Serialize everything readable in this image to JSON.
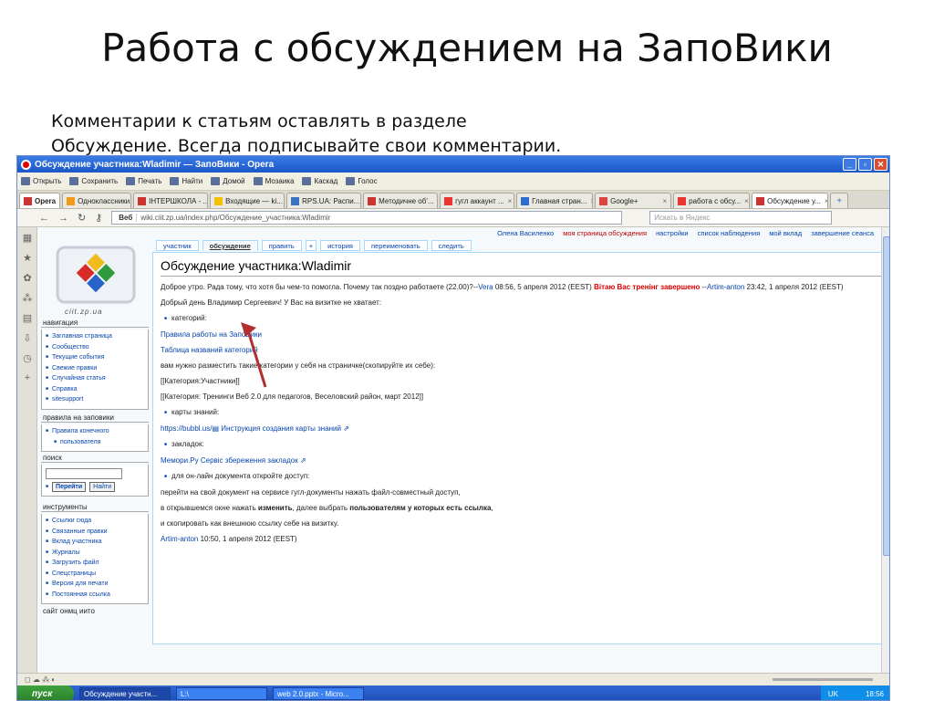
{
  "slide": {
    "title": "Работа с обсуждением на ЗапоВики",
    "text_line1": "Комментарии к статьям оставлять в разделе",
    "text_line2": "Обсуждение. Всегда подписывайте свои комментарии."
  },
  "window": {
    "title": "Обсуждение участника:Wladimir — ЗапоВики - Opera"
  },
  "toolbar": [
    "Открыть",
    "Сохранить",
    "Печать",
    "Найти",
    "Домой",
    "Мозаика",
    "Каскад",
    "Голос"
  ],
  "tabs": [
    {
      "label": "Opera",
      "active": false,
      "opera": true
    },
    {
      "label": "Одноклассники",
      "active": false
    },
    {
      "label": "ІНТЕРШКОЛА - ...",
      "active": false
    },
    {
      "label": "Входящие — ki...",
      "active": false
    },
    {
      "label": "RPS.UA: Распи...",
      "active": false
    },
    {
      "label": "Методичне об'...",
      "active": false
    },
    {
      "label": "гугл аккаунт ...",
      "active": false
    },
    {
      "label": "Главная стран...",
      "active": false
    },
    {
      "label": "Google+",
      "active": false
    },
    {
      "label": "работа с обсу...",
      "active": false
    },
    {
      "label": "Обсуждение у...",
      "active": true
    }
  ],
  "address": {
    "web_label": "Веб",
    "url": "wiki.ciit.zp.ua/index.php/Обсуждение_участника:Wladimir",
    "search_placeholder": "Искать в Яндекс"
  },
  "usernav": {
    "user": "Олена Василенко",
    "new_talk": "моя страница обсуждения",
    "items": [
      "настройки",
      "список наблюдения",
      "мой вклад",
      "завершение сеанса"
    ]
  },
  "logo_caption": "ciit.zp.ua",
  "sidebar": {
    "navigation": {
      "title": "навигация",
      "items": [
        "Заглавная страница",
        "Сообщество",
        "Текущие события",
        "Свежие правки",
        "Случайная статья",
        "Справка",
        "sitesupport"
      ]
    },
    "rules": {
      "title": "правила на заповики",
      "items": [
        "Правила конечного",
        "пользователя"
      ]
    },
    "search": {
      "title": "поиск",
      "go": "Перейти",
      "find": "Найти"
    },
    "tools": {
      "title": "инструменты",
      "items": [
        "Ссылки сюда",
        "Связанные правки",
        "Вклад участника",
        "Журналы",
        "Загрузить файл",
        "Спецстраницы",
        "Версия для печати",
        "Постоянная ссылка"
      ]
    },
    "site": {
      "title": "сайт онмц иито"
    }
  },
  "page_tabs": [
    "участник",
    "обсуждение",
    "править",
    "+",
    "история",
    "переименовать",
    "следить"
  ],
  "content": {
    "heading": "Обсуждение участника:Wladimir",
    "p1_text": "Доброе утро. Рада тому, что хотя бы чем-то помогла. Почему так поздно работаете (22.00)?--",
    "p1_link1": "Vera",
    "p1_time": " 08:56, 5 апреля 2012 (EEST) ",
    "p1_warn": "Вітаю Вас тренінг завершено",
    "p1_dash": " --",
    "p1_link2": "Artim-anton",
    "p1_time2": " 23:42, 1 апреля 2012 (EEST)",
    "p2": "Добрый день Владимир Сергеевич! У Вас на визитке не хватает:",
    "b1": "категорий:",
    "l1": "Правила работы на ЗапоВики",
    "l2": "Таблица названий категорий",
    "p3": "вам нужно разместить такие категории у себя на страничке(скопируйте их себе):",
    "p4": "[[Категория:Участники]]",
    "p5": "[[Категория: Тренинги Веб 2.0 для педагогов, Веселовский район, март 2012]]",
    "b2": "карты знаний:",
    "l3a": "https://bubbl.us/",
    "l3b": " Инструкция создания карты знаний",
    "b3": "закладок:",
    "l4": "Мемори.Ру Сервіс збереження закладок",
    "b4": "для он-лайн документа откройте доступ:",
    "p6": "перейти на свой документ на сервисе гугл-документы нажать файл-совместный доступ,",
    "p7a": "в открывшемся окне нажать ",
    "p7b": "изменить",
    "p7c": ", далее выбрать ",
    "p7d": "пользователям у которых есть ссылка",
    "p7e": ",",
    "p8": "и скопировать как внешнюю ссылку себе на визитку.",
    "sig_link": "Artim-anton",
    "sig_time": " 10:50, 1 апреля 2012 (EEST)"
  },
  "taskbar": {
    "start": "пуск",
    "tasks": [
      "Обсуждение участн...",
      "L:\\",
      "web 2.0.pptx - Micro..."
    ],
    "lang": "UK",
    "clock": "18:56"
  },
  "colors": {
    "link": "#0645ad",
    "warn": "#dd0000",
    "arrow": "#b03030"
  }
}
